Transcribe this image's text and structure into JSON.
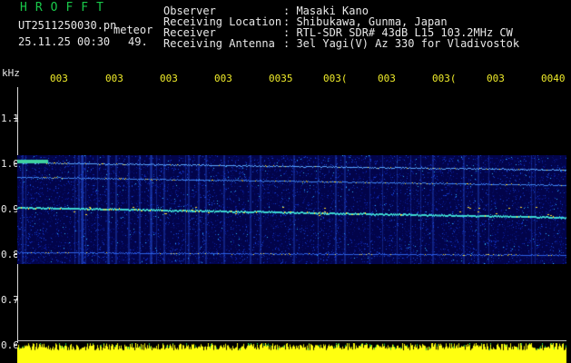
{
  "header": {
    "logo": "HROFFT",
    "filename": "UT2511250030.pn",
    "meteor_label": "meteor",
    "datetime": "25.11.25 00:30",
    "count": "49.",
    "info_labels": [
      "Observer",
      "Receiving Location",
      "Receiver",
      "Receiving Antenna"
    ],
    "info_values": [
      ": Masaki Kano",
      ": Shibukawa, Gunma, Japan",
      ": RTL-SDR SDR# 43dB L15 103.2MHz CW",
      ": 3el Yagi(V) Az 330 for Vladivostok"
    ]
  },
  "axis": {
    "unit": "kHz",
    "y_labels": [
      "1.1",
      "1.0",
      "0.9",
      "0.8",
      "0.7",
      "0.6"
    ],
    "time_labels": [
      "003",
      "003",
      "003",
      "003",
      "0035",
      "003(",
      "003",
      "003(",
      "003",
      "0040"
    ]
  },
  "colors": {
    "background": "#000000",
    "text": "#e8e8e8",
    "time_label": "#f0ec2a",
    "logo": "#19c94a",
    "spectrogram_low": "#0a1a8a",
    "spectrogram_high": "#ffe030",
    "signal_bar": "#ffff10"
  }
}
